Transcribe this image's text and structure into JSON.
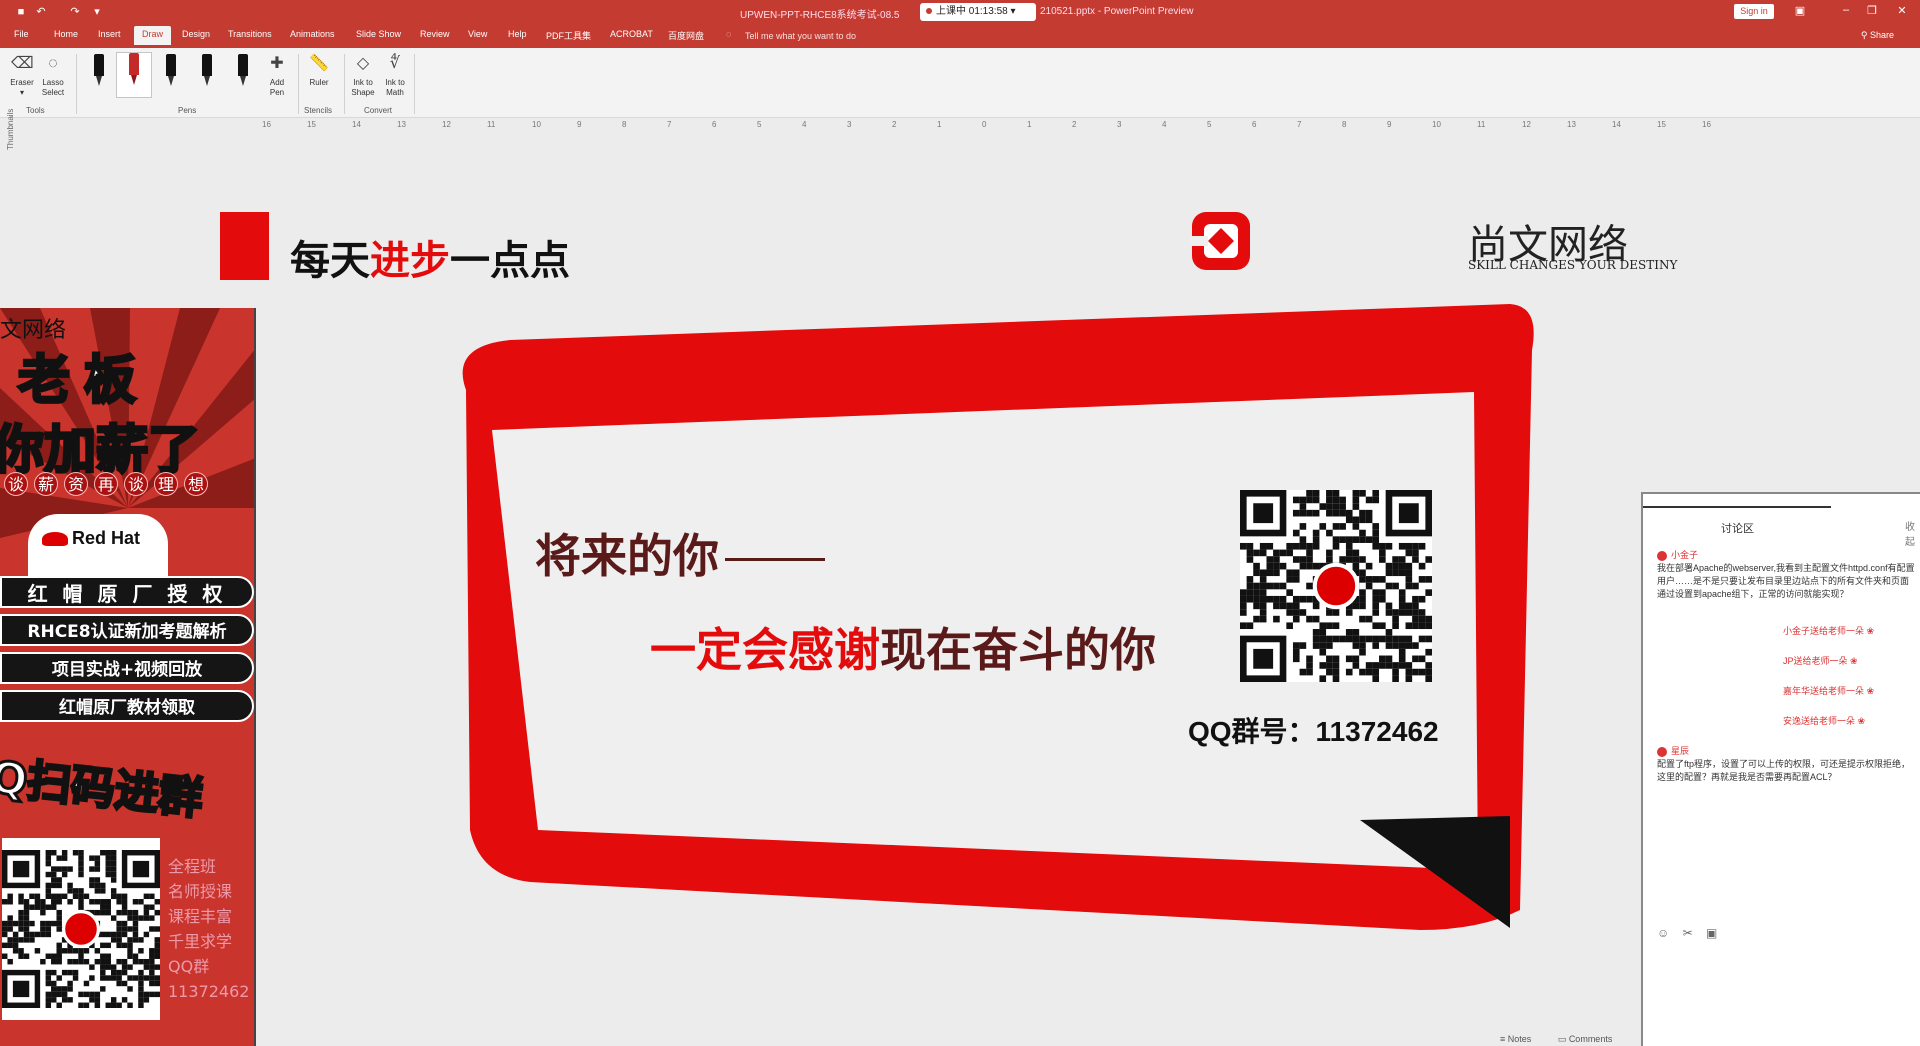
{
  "titlebar": {
    "title": "UPWEN-PPT-RHCE8系统考试-08.5",
    "recording": "上课中 01:13:58",
    "file_suffix": "210521.pptx - PowerPoint Preview",
    "signin": "Sign in"
  },
  "tabs": [
    "File",
    "Home",
    "Insert",
    "Draw",
    "Design",
    "Transitions",
    "Animations",
    "Slide Show",
    "Review",
    "View",
    "Help",
    "PDF工具集",
    "ACROBAT",
    "百度网盘"
  ],
  "tell_me": "Tell me what you want to do",
  "share": "Share",
  "ribbon": {
    "eraser": "Eraser",
    "lasso": "Lasso Select",
    "tools_group": "Tools",
    "pens_group": "Pens",
    "add_pen": "Add Pen",
    "ruler": "Ruler",
    "stencils_group": "Stencils",
    "ink_to_shape": "Ink to Shape",
    "ink_to_math": "Ink to Math",
    "convert_group": "Convert"
  },
  "ruler_ticks": [
    "16",
    "15",
    "14",
    "13",
    "12",
    "11",
    "10",
    "9",
    "8",
    "7",
    "6",
    "5",
    "4",
    "3",
    "2",
    "1",
    "0",
    "1",
    "2",
    "3",
    "4",
    "5",
    "6",
    "7",
    "8",
    "9",
    "10",
    "11",
    "12",
    "13",
    "14",
    "15",
    "16"
  ],
  "thumbnails_label": "Thumbnails",
  "slide": {
    "slogan_a": "每天",
    "slogan_b": "进步",
    "slogan_c": "一点点",
    "brand_cn": "尚文网络",
    "brand_en": "SKILL CHANGES YOUR DESTINY",
    "quote1": "将来的你",
    "quote2_red": "一定会感谢",
    "quote2_rest": "现在奋斗的你",
    "qq_line": "QQ群号：11372462"
  },
  "ad": {
    "brand": "文网络",
    "t1": "老板",
    "t2": "你加薪了",
    "row3": [
      "谈",
      "薪",
      "资",
      "再",
      "谈",
      "理",
      "想"
    ],
    "redhat": "Red Hat",
    "bar1": "红 帽 原 厂 授 权",
    "bar2": "RHCE8认证新加考题解析",
    "bar3": "项目实战+视频回放",
    "bar4": "红帽原厂教材领取",
    "qq_join": "Q扫码进群",
    "side_lines": [
      "全程班",
      "名师授课",
      "课程丰富",
      "千里求学",
      "QQ群",
      "11372462"
    ]
  },
  "discussion": {
    "title": "讨论区",
    "close": "收起",
    "user1": "小金子",
    "msg1": "我在部署Apache的webserver,我看到主配置文件httpd.conf有配置用户……是不是只要让发布目录里边站点下的所有文件夹和页面通过设置到apache组下，正常的访问就能实现？",
    "gifts": [
      "小金子送给老师一朵 ❀",
      "JP送给老师一朵 ❀",
      "嘉年华送给老师一朵 ❀",
      "安逸送给老师一朵 ❀"
    ],
    "user2": "星辰",
    "msg2": "配置了ftp程序，设置了可以上传的权限，可还是提示权限拒绝，这里的配置？再就是我是否需要再配置ACL？",
    "tools": [
      "☺",
      "✂",
      "▣"
    ]
  },
  "statusbar": {
    "notes": "Notes",
    "comments": "Comments"
  },
  "colors": {
    "accent": "#c43b32",
    "slide_red": "#e30b0b"
  }
}
